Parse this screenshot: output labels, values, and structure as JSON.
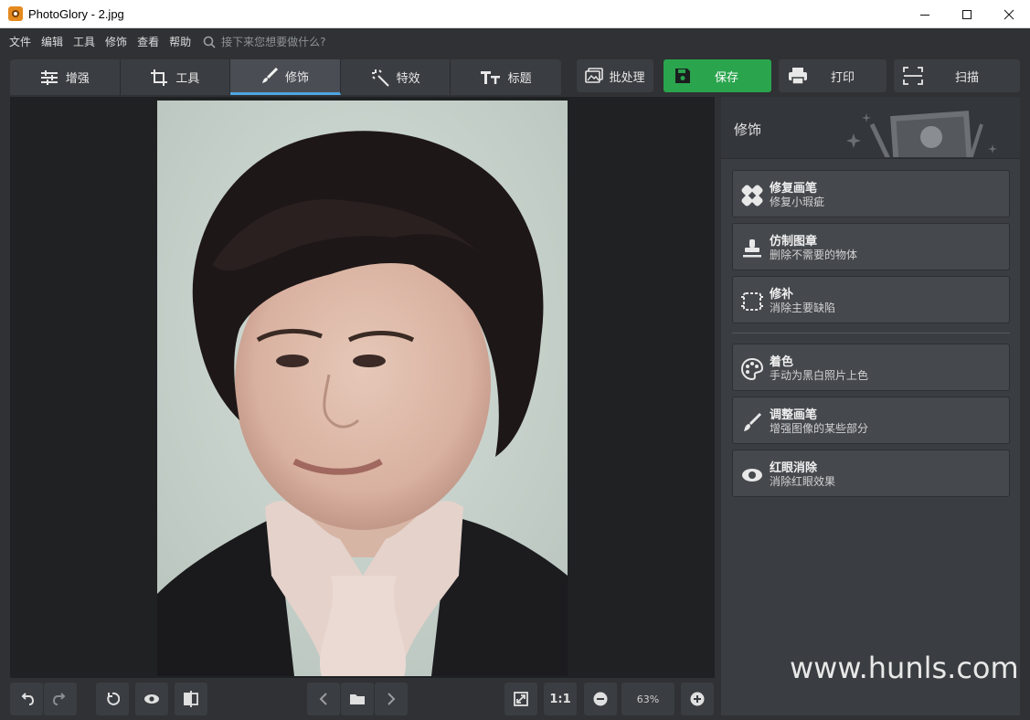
{
  "window": {
    "title": "PhotoGlory - 2.jpg"
  },
  "menu": {
    "items": [
      "文件",
      "编辑",
      "工具",
      "修饰",
      "查看",
      "帮助"
    ],
    "search_placeholder": "接下来您想要做什么?"
  },
  "tabs": [
    {
      "label": "增强",
      "icon": "sliders-icon"
    },
    {
      "label": "工具",
      "icon": "crop-icon"
    },
    {
      "label": "修饰",
      "icon": "brush-icon",
      "active": true
    },
    {
      "label": "特效",
      "icon": "magic-wand-icon"
    },
    {
      "label": "标题",
      "icon": "text-icon"
    }
  ],
  "actions": {
    "batch": "批处理",
    "save": "保存",
    "print": "打印",
    "scan": "扫描"
  },
  "bottom": {
    "ratio": "1:1",
    "zoom": "63%"
  },
  "panel": {
    "title": "修饰",
    "tools": [
      {
        "name": "修复画笔",
        "desc": "修复小瑕疵",
        "icon": "bandage-icon"
      },
      {
        "name": "仿制图章",
        "desc": "删除不需要的物体",
        "icon": "stamp-icon"
      },
      {
        "name": "修补",
        "desc": "消除主要缺陷",
        "icon": "patch-icon"
      },
      {
        "name": "着色",
        "desc": "手动为黑白照片上色",
        "icon": "palette-icon"
      },
      {
        "name": "调整画笔",
        "desc": "增强图像的某些部分",
        "icon": "adjust-brush-icon"
      },
      {
        "name": "红眼消除",
        "desc": "消除红眼效果",
        "icon": "eye-icon"
      }
    ]
  },
  "watermark": "www.hunls.com",
  "colors": {
    "accent": "#4fa3e0",
    "save": "#2aa44d",
    "background": "#2f3134"
  }
}
